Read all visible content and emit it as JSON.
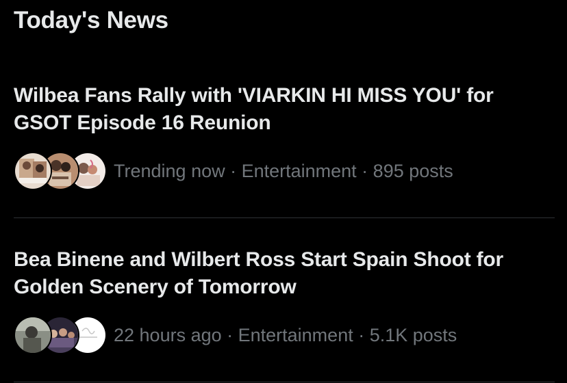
{
  "section": {
    "title": "Today's News"
  },
  "news": [
    {
      "headline": "Wilbea Fans Rally with 'VIARKIN HI MISS YOU' for GSOT Episode 16 Reunion",
      "meta": "Trending now · Entertainment · 895 posts",
      "avatars": [
        "avatar-photo-collage",
        "avatar-wilbea-logo",
        "avatar-couple-photo"
      ]
    },
    {
      "headline": "Bea Binene and Wilbert Ross Start Spain Shoot for Golden Scenery of Tomorrow",
      "meta": "22 hours ago · Entertainment · 5.1K posts",
      "avatars": [
        "avatar-portrait-photo",
        "avatar-group-photo",
        "avatar-script-logo"
      ]
    }
  ],
  "colors": {
    "background": "#000000",
    "primary_text": "#e7e9ea",
    "secondary_text": "#71767b",
    "divider": "#2f3336"
  }
}
